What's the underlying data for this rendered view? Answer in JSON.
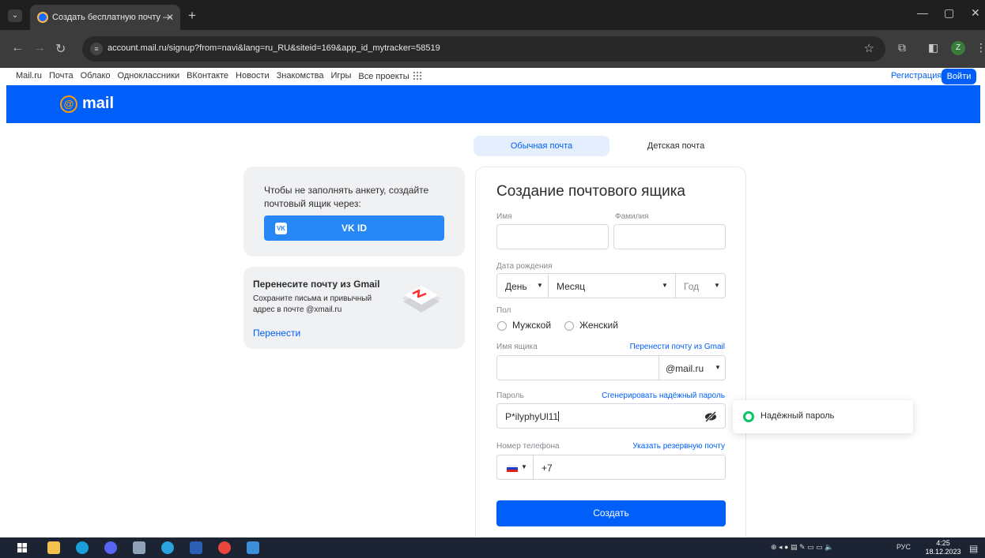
{
  "browser": {
    "tab_title": "Создать бесплатную почту —",
    "url": "account.mail.ru/signup?from=navi&lang=ru_RU&siteid=169&app_id_mytracker=58519",
    "profile_letter": "Z"
  },
  "portal_nav": {
    "links": [
      "Mail.ru",
      "Почта",
      "Облако",
      "Одноклассники",
      "ВКонтакте",
      "Новости",
      "Знакомства",
      "Игры",
      "Все проекты"
    ],
    "register": "Регистрация",
    "login": "Войти"
  },
  "header": {
    "logo_text": "mail",
    "brand_color": "#005ff9",
    "accent_color": "#ff9e00"
  },
  "vk_card": {
    "text": "Чтобы не заполнять анкету, создайте почтовый ящик через:",
    "button_label": "VK ID",
    "logo_text": "VK"
  },
  "gmail_card": {
    "title": "Перенесите почту из Gmail",
    "description": "Сохраните письма и привычный адрес в почте @xmail.ru",
    "link": "Перенести"
  },
  "tabs": {
    "ordinary": "Обычная почта",
    "kids": "Детская почта"
  },
  "form": {
    "title": "Создание почтового ящика",
    "first_name_label": "Имя",
    "last_name_label": "Фамилия",
    "birthdate_label": "Дата рождения",
    "day": "День",
    "month": "Месяц",
    "year": "Год",
    "gender_label": "Пол",
    "male": "Мужской",
    "female": "Женский",
    "mailbox_label": "Имя ящика",
    "mailbox_link": "Перенести почту из Gmail",
    "domain": "@mail.ru",
    "password_label": "Пароль",
    "password_link": "Сгенерировать надёжный пароль",
    "password_value": "P*ilyphyUl11",
    "phone_label": "Номер телефона",
    "phone_link": "Указать резервную почту",
    "phone_prefix": "+7",
    "submit": "Создать"
  },
  "tooltip": {
    "text": "Надёжный пароль",
    "color": "#0dc268"
  },
  "taskbar": {
    "lang": "РУС",
    "time": "4:25",
    "date": "18.12.2023"
  }
}
